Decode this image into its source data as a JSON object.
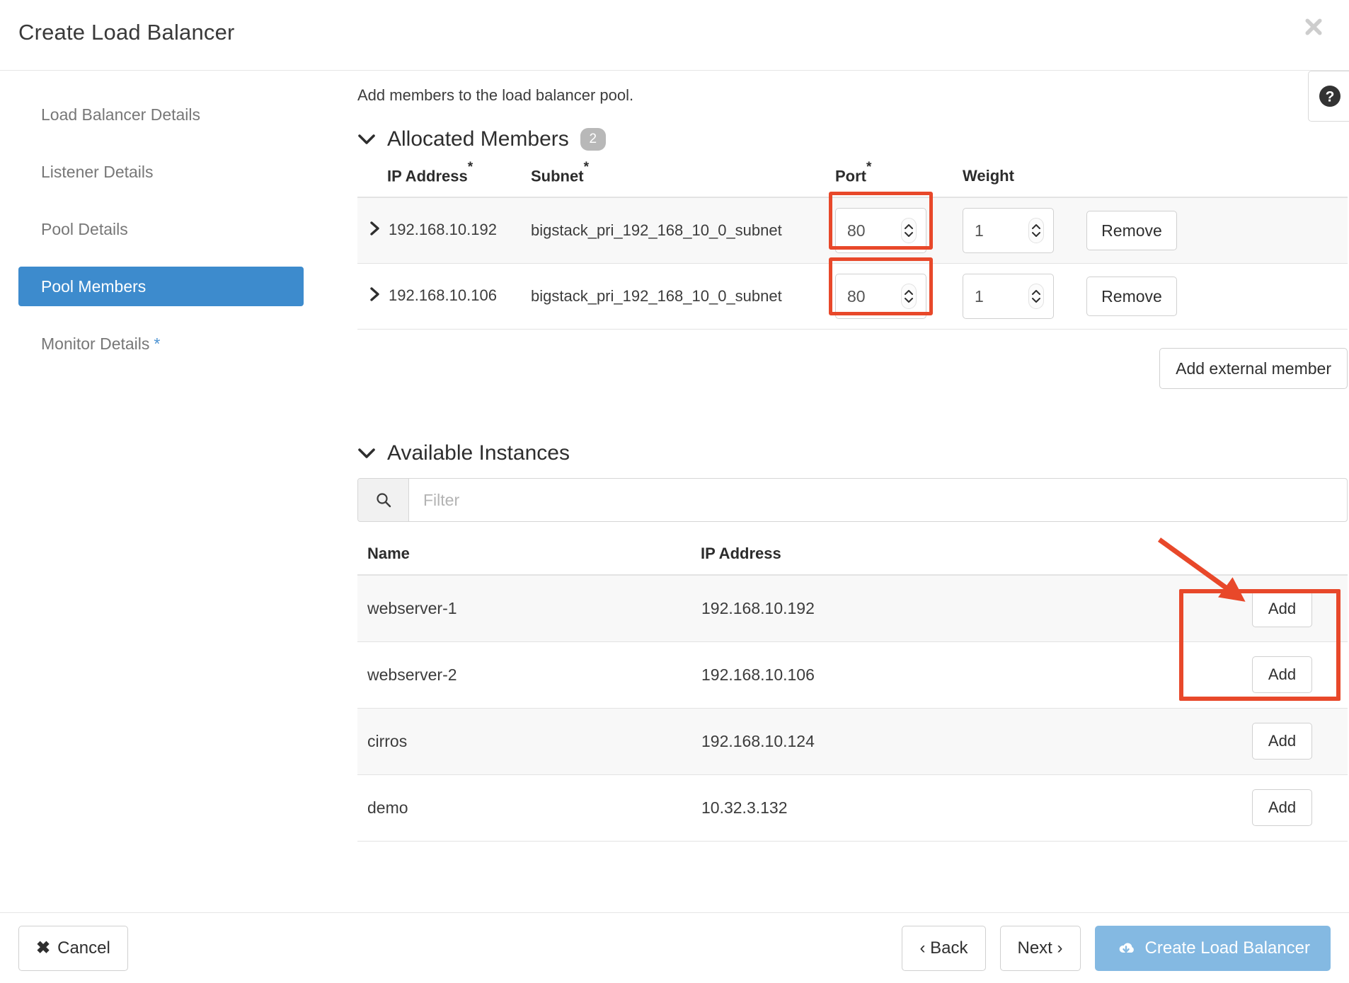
{
  "modal": {
    "title": "Create Load Balancer",
    "close_icon": "close-icon",
    "help_icon": "help-circle-icon"
  },
  "sidebar": {
    "items": [
      {
        "label": "Load Balancer Details",
        "active": false,
        "required": false
      },
      {
        "label": "Listener Details",
        "active": false,
        "required": false
      },
      {
        "label": "Pool Details",
        "active": false,
        "required": false
      },
      {
        "label": "Pool Members",
        "active": true,
        "required": false
      },
      {
        "label": "Monitor Details",
        "active": false,
        "required": true,
        "required_mark": "*"
      }
    ]
  },
  "content": {
    "intro": "Add members to the load balancer pool.",
    "allocated": {
      "heading": "Allocated Members",
      "count": "2",
      "columns": {
        "ip": "IP Address",
        "ip_required": "*",
        "subnet": "Subnet",
        "subnet_required": "*",
        "port": "Port",
        "port_required": "*",
        "weight": "Weight"
      },
      "rows": [
        {
          "ip": "192.168.10.192",
          "subnet": "bigstack_pri_192_168_10_0_subnet",
          "port": "80",
          "weight": "1",
          "remove_label": "Remove"
        },
        {
          "ip": "192.168.10.106",
          "subnet": "bigstack_pri_192_168_10_0_subnet",
          "port": "80",
          "weight": "1",
          "remove_label": "Remove"
        }
      ],
      "add_external_label": "Add external member"
    },
    "available": {
      "heading": "Available Instances",
      "filter_placeholder": "Filter",
      "filter_value": "",
      "search_icon": "search-icon",
      "columns": {
        "name": "Name",
        "ip": "IP Address"
      },
      "rows": [
        {
          "name": "webserver-1",
          "ip": "192.168.10.192",
          "add_label": "Add"
        },
        {
          "name": "webserver-2",
          "ip": "192.168.10.106",
          "add_label": "Add"
        },
        {
          "name": "cirros",
          "ip": "192.168.10.124",
          "add_label": "Add"
        },
        {
          "name": "demo",
          "ip": "10.32.3.132",
          "add_label": "Add"
        }
      ]
    }
  },
  "footer": {
    "cancel": "Cancel",
    "back": "‹ Back",
    "next": "Next ›",
    "create": "Create Load Balancer"
  },
  "colors": {
    "accent_blue": "#3d8bcd",
    "primary_button": "#84b9e2",
    "annotation_red": "#e8482a",
    "badge_gray": "#b8b8b8",
    "required_star_blue": "#4d93d2"
  }
}
